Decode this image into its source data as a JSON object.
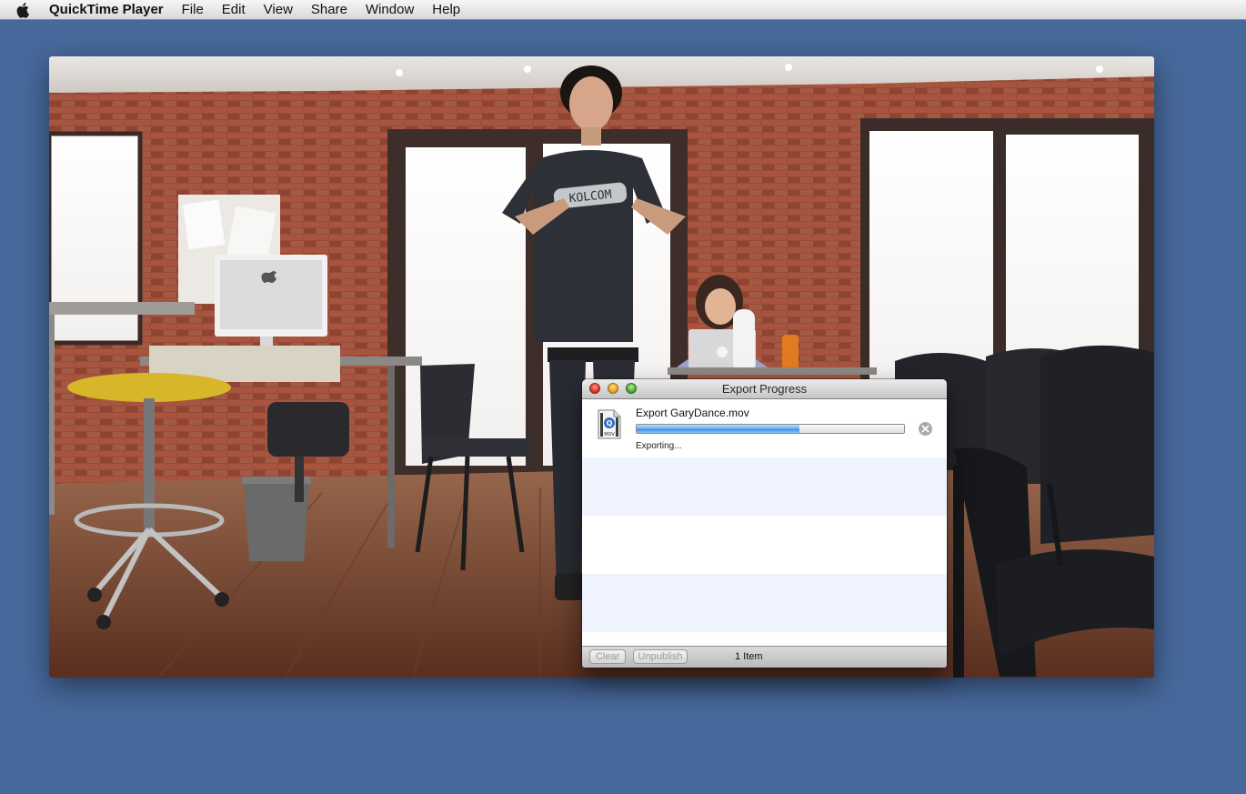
{
  "menubar": {
    "app_name": "QuickTime Player",
    "items": [
      "File",
      "Edit",
      "View",
      "Share",
      "Window",
      "Help"
    ]
  },
  "video": {
    "shirt_text": "KOLCOM"
  },
  "export_window": {
    "title": "Export Progress",
    "item": {
      "title": "Export GaryDance.mov",
      "icon": "mov-file-icon",
      "icon_label": "MOV",
      "status": "Exporting...",
      "progress": 0.61
    },
    "footer": {
      "clear_label": "Clear",
      "unpublish_label": "Unpublish",
      "count_text": "1 Item"
    }
  },
  "colors": {
    "desktop": "#47689b",
    "progress_blue": "#3f8de0"
  }
}
